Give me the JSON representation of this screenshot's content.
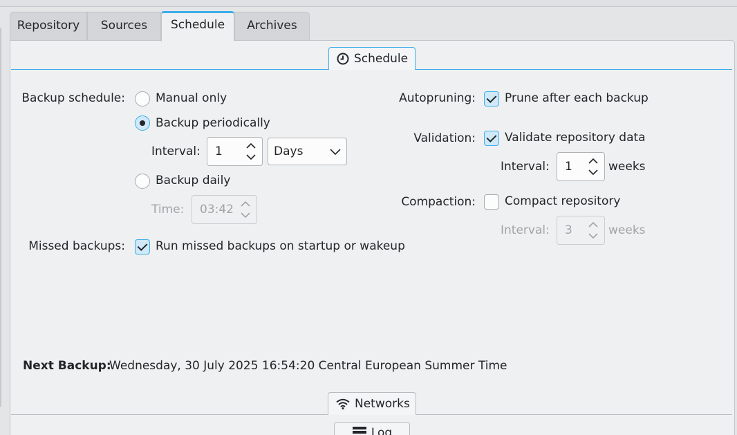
{
  "tabs": [
    {
      "label": "Repository"
    },
    {
      "label": "Sources"
    },
    {
      "label": "Schedule"
    },
    {
      "label": "Archives"
    }
  ],
  "group": {
    "schedule_title": "Schedule",
    "networks_title": "Networks",
    "log_title": "Log"
  },
  "schedule": {
    "label": "Backup schedule:",
    "manual_only": "Manual only",
    "periodically": "Backup periodically",
    "interval_label": "Interval:",
    "interval_value": "1",
    "interval_unit": "Days",
    "daily": "Backup daily",
    "time_label": "Time:",
    "time_value": "03:42",
    "selected": "periodically"
  },
  "missed": {
    "label": "Missed backups:",
    "option": "Run missed backups on startup or wakeup",
    "checked": true
  },
  "autopruning": {
    "label": "Autopruning:",
    "option": "Prune after each backup",
    "checked": true
  },
  "validation": {
    "label": "Validation:",
    "option": "Validate repository data",
    "checked": true,
    "interval_label": "Interval:",
    "interval_value": "1",
    "interval_unit": "weeks"
  },
  "compaction": {
    "label": "Compaction:",
    "option": "Compact repository",
    "checked": false,
    "interval_label": "Interval:",
    "interval_value": "3",
    "interval_unit": "weeks"
  },
  "next_backup": {
    "label": "Next Backup:",
    "value": "Wednesday, 30 July 2025 16:54:20 Central European Summer Time"
  },
  "colors": {
    "accent": "#3daee9",
    "window_bg": "#eff0f1",
    "text": "#232629",
    "disabled_text": "#a2a4a7"
  },
  "icons": {
    "schedule": "clock-icon",
    "networks": "wifi-icon",
    "log": "log-icon"
  }
}
